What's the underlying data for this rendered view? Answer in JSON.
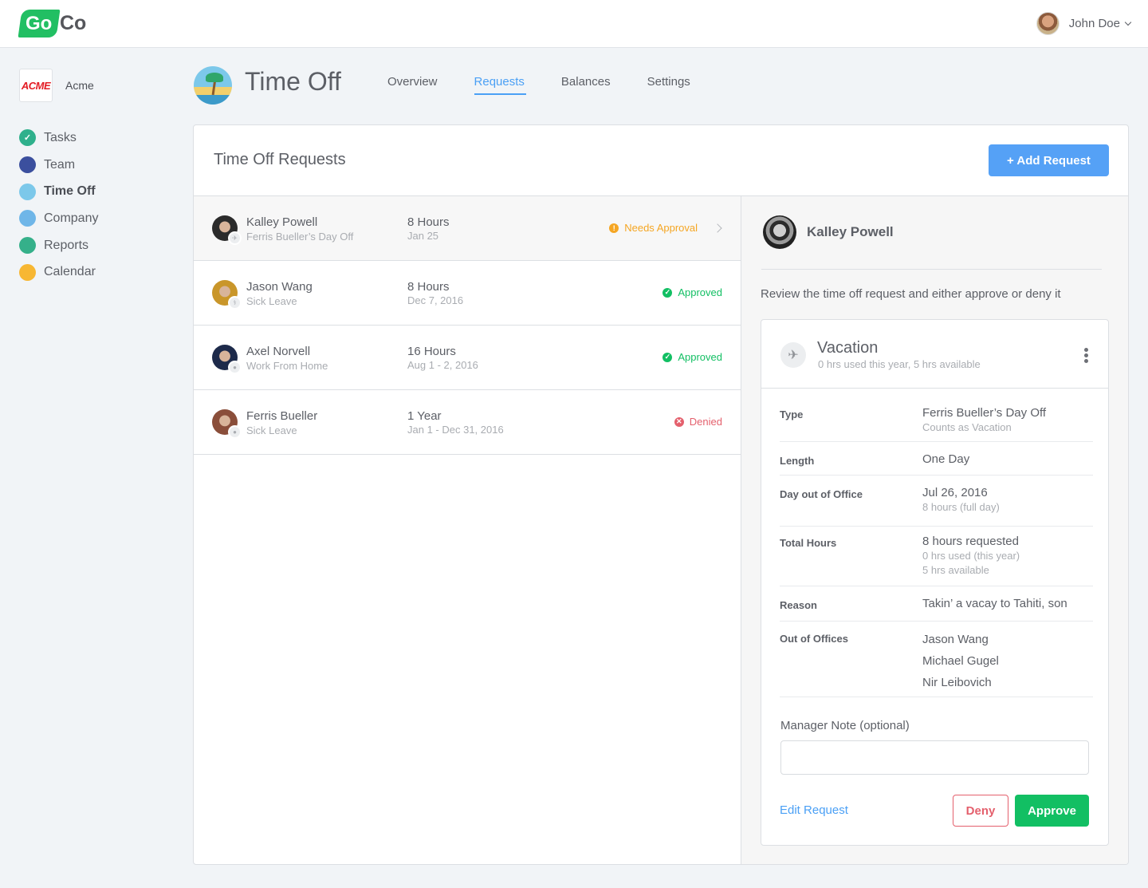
{
  "header": {
    "logo_left": "Go",
    "logo_right": "Co",
    "user_name": "John Doe"
  },
  "sidebar": {
    "company_logo_text": "ACME",
    "company_name": "Acme",
    "items": [
      {
        "label": "Tasks",
        "icon": "check-icon",
        "color": "#2fb08c",
        "glyph": "✓"
      },
      {
        "label": "Team",
        "icon": "team-icon",
        "color": "#3b4f9e",
        "glyph": "👥"
      },
      {
        "label": "Time Off",
        "icon": "beach-icon",
        "color": "#7cc8ea",
        "glyph": "🌴",
        "active": true
      },
      {
        "label": "Company",
        "icon": "building-icon",
        "color": "#6fb6e8",
        "glyph": "▦"
      },
      {
        "label": "Reports",
        "icon": "report-icon",
        "color": "#35b08a",
        "glyph": "▣"
      },
      {
        "label": "Calendar",
        "icon": "calendar-icon",
        "color": "#f7b733",
        "glyph": "▤"
      }
    ]
  },
  "page": {
    "title": "Time Off",
    "tabs": [
      {
        "label": "Overview"
      },
      {
        "label": "Requests",
        "active": true
      },
      {
        "label": "Balances"
      },
      {
        "label": "Settings"
      }
    ]
  },
  "panel": {
    "title": "Time Off Requests",
    "add_button": "+ Add Request"
  },
  "requests": [
    {
      "name": "Kalley Powell",
      "type": "Ferris Bueller’s Day Off",
      "amount": "8 Hours",
      "date": "Jan 25",
      "status": "Needs Approval",
      "status_color": "#f5a623",
      "status_glyph": "!",
      "badge": "✈",
      "avatar_color": "#2b2b2b",
      "selected": true
    },
    {
      "name": "Jason Wang",
      "type": "Sick Leave",
      "amount": "8 Hours",
      "date": "Dec 7, 2016",
      "status": "Approved",
      "status_color": "#12bf63",
      "status_glyph": "✓",
      "badge": "⚕",
      "avatar_color": "#c9962a"
    },
    {
      "name": "Axel Norvell",
      "type": "Work From Home",
      "amount": "16 Hours",
      "date": "Aug 1 - 2, 2016",
      "status": "Approved",
      "status_color": "#12bf63",
      "status_glyph": "✓",
      "badge": "●",
      "avatar_color": "#1d2a4a"
    },
    {
      "name": "Ferris Bueller",
      "type": "Sick Leave",
      "amount": "1 Year",
      "date": "Jan 1 - Dec 31, 2016",
      "status": "Denied",
      "status_color": "#e4606d",
      "status_glyph": "✕",
      "badge": "●",
      "avatar_color": "#8a4e3a"
    }
  ],
  "detail": {
    "name": "Kalley Powell",
    "hint": "Review the time off request and either approve or deny it",
    "card": {
      "title": "Vacation",
      "subtitle": "0 hrs used this year, 5 hrs available",
      "fields": {
        "type": {
          "label": "Type",
          "value": "Ferris Bueller’s Day Off",
          "sub": "Counts as Vacation"
        },
        "length": {
          "label": "Length",
          "value": "One Day"
        },
        "day_out": {
          "label": "Day out of Office",
          "value": "Jul 26, 2016",
          "sub": "8 hours (full day)"
        },
        "total": {
          "label": "Total Hours",
          "value": "8 hours requested",
          "sub1": "0 hrs used (this year)",
          "sub2": "5 hrs available"
        },
        "reason": {
          "label": "Reason",
          "value": "Takin’ a vacay to Tahiti, son"
        },
        "out_of_offices": {
          "label": "Out of Offices",
          "people": [
            "Jason Wang",
            "Michael Gugel",
            "Nir Leibovich"
          ]
        }
      },
      "note_label": "Manager Note (optional)",
      "note_value": "",
      "note_placeholder": "",
      "edit_link": "Edit Request",
      "deny_button": "Deny",
      "approve_button": "Approve"
    }
  }
}
